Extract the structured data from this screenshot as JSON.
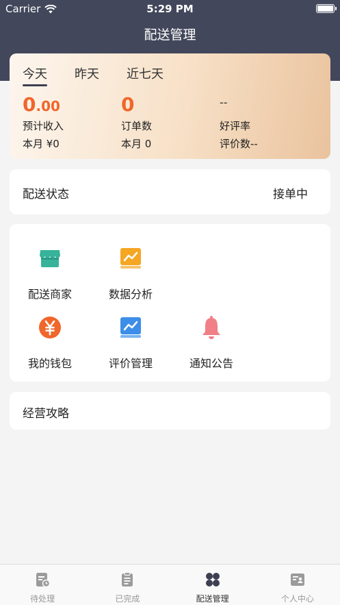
{
  "status_bar": {
    "carrier": "Carrier",
    "time": "5:29 PM"
  },
  "nav": {
    "title": "配送管理"
  },
  "stats": {
    "tabs": [
      {
        "label": "今天",
        "active": true
      },
      {
        "label": "昨天",
        "active": false
      },
      {
        "label": "近七天",
        "active": false
      }
    ],
    "income": {
      "value_int": "0",
      "value_dec": ".00",
      "label": "预计收入",
      "month": "本月 ¥0"
    },
    "orders": {
      "value": "0",
      "label": "订单数",
      "month": "本月 0"
    },
    "rating": {
      "value": "--",
      "label": "好评率",
      "count": "评价数--"
    }
  },
  "delivery_status": {
    "title": "配送状态",
    "value": "接单中"
  },
  "grid": {
    "items": [
      {
        "label": "配送商家",
        "icon": "store-icon",
        "color": "#36b39a"
      },
      {
        "label": "数据分析",
        "icon": "chart-icon",
        "color": "#f5a623"
      },
      {
        "label": "我的钱包",
        "icon": "wallet-yen-icon",
        "color": "#f0662b"
      },
      {
        "label": "评价管理",
        "icon": "review-chart-icon",
        "color": "#3d8ee8"
      },
      {
        "label": "通知公告",
        "icon": "bell-icon",
        "color": "#f07f86"
      }
    ]
  },
  "strategy": {
    "title": "经营攻略"
  },
  "tabbar": {
    "items": [
      {
        "label": "待处理",
        "icon": "pending-icon",
        "active": false
      },
      {
        "label": "已完成",
        "icon": "clipboard-icon",
        "active": false
      },
      {
        "label": "配送管理",
        "icon": "grid-icon",
        "active": true
      },
      {
        "label": "个人中心",
        "icon": "profile-card-icon",
        "active": false
      }
    ]
  }
}
